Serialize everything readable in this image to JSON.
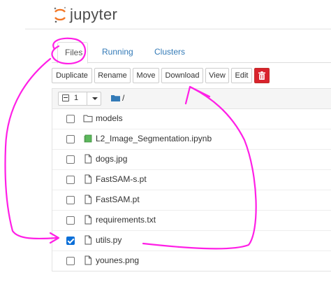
{
  "header": {
    "logo_text": "jupyter",
    "logo_icon": "jupyter-logo-icon",
    "brand_color": "#f37726"
  },
  "tabs": [
    {
      "label": "Files",
      "active": true
    },
    {
      "label": "Running",
      "active": false
    },
    {
      "label": "Clusters",
      "active": false
    }
  ],
  "toolbar": {
    "duplicate": "Duplicate",
    "rename": "Rename",
    "move": "Move",
    "download": "Download",
    "view": "View",
    "edit": "Edit",
    "delete_icon": "trash-icon"
  },
  "list_header": {
    "selected_count": "1",
    "breadcrumb": "/",
    "breadcrumb_icon": "folder-icon"
  },
  "files": [
    {
      "name": "models",
      "type": "folder",
      "icon": "folder-icon",
      "checked": false
    },
    {
      "name": "L2_Image_Segmentation.ipynb",
      "type": "notebook",
      "icon": "notebook-icon",
      "checked": false
    },
    {
      "name": "dogs.jpg",
      "type": "file",
      "icon": "file-icon",
      "checked": false
    },
    {
      "name": "FastSAM-s.pt",
      "type": "file",
      "icon": "file-icon",
      "checked": false
    },
    {
      "name": "FastSAM.pt",
      "type": "file",
      "icon": "file-icon",
      "checked": false
    },
    {
      "name": "requirements.txt",
      "type": "file",
      "icon": "file-icon",
      "checked": false
    },
    {
      "name": "utils.py",
      "type": "file",
      "icon": "file-icon",
      "checked": true
    },
    {
      "name": "younes.png",
      "type": "file",
      "icon": "file-icon",
      "checked": false
    }
  ],
  "annotation_color": "#ff1fe6"
}
